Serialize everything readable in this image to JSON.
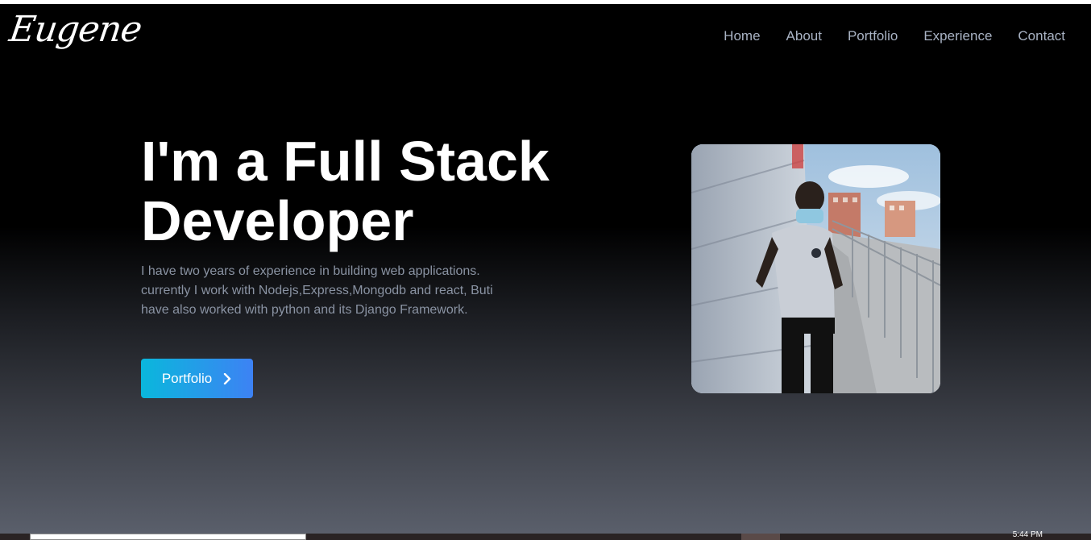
{
  "brand": {
    "logo_text": "Eugene"
  },
  "nav": {
    "items": [
      {
        "label": "Home"
      },
      {
        "label": "About"
      },
      {
        "label": "Portfolio"
      },
      {
        "label": "Experience"
      },
      {
        "label": "Contact"
      }
    ]
  },
  "hero": {
    "title_line1": "I'm a Full Stack",
    "title_line2": "Developer",
    "description": "I have two years of experience in building web applications. currently I work with Nodejs,Express,Mongodb and react, Buti have also worked with python and its Django Framework.",
    "cta_label": "Portfolio",
    "cta_icon": "chevron-right-icon",
    "photo_alt": "Profile photo"
  },
  "taskbar": {
    "clock": "5:44 PM"
  },
  "colors": {
    "background_top": "#000000",
    "background_bottom": "#5a5f6b",
    "nav_text": "#a9b3c4",
    "description_text": "#8a93a3",
    "button_start": "#0ab7dc",
    "button_end": "#3d82f4"
  }
}
